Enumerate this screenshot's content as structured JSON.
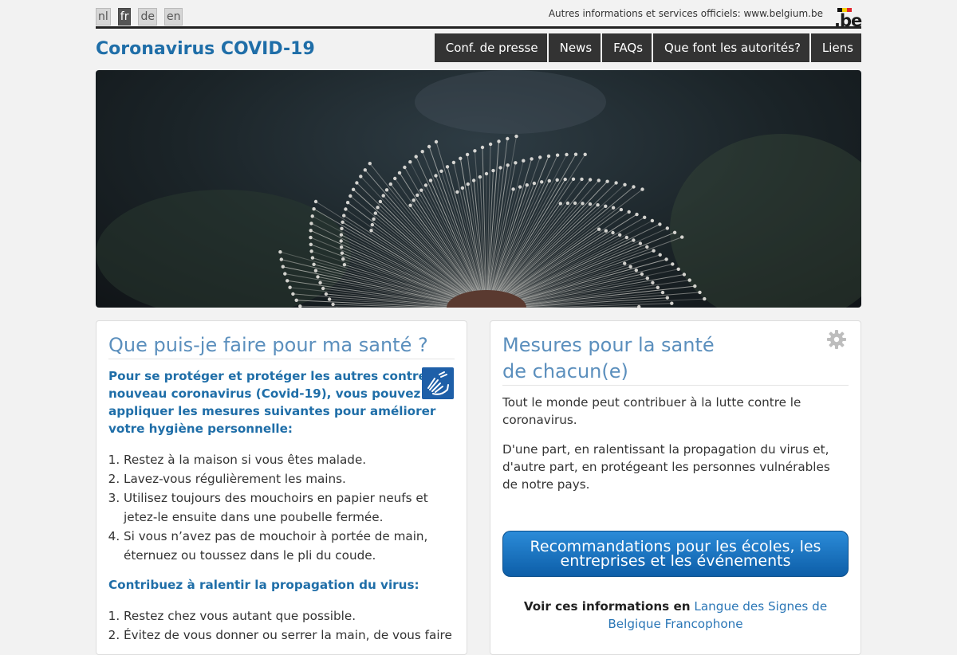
{
  "languages": [
    {
      "code": "nl",
      "active": false
    },
    {
      "code": "fr",
      "active": true
    },
    {
      "code": "de",
      "active": false
    },
    {
      "code": "en",
      "active": false
    }
  ],
  "official_link_text": "Autres informations et services officiels: www.belgium.be",
  "logo_text": ".be",
  "brand_colors": {
    "title": "#1f6ea8",
    "heading": "#5b8fbd",
    "nav_bg": "#333333",
    "button": "#1a73c2"
  },
  "site_title": "Coronavirus COVID-19",
  "nav": [
    "Conf. de presse",
    "News",
    "FAQs",
    "Que font les autorités?",
    "Liens"
  ],
  "left_card": {
    "heading": "Que puis-je faire pour ma santé ?",
    "intro": "Pour se protéger et protéger les autres contre le nouveau coronavirus (Covid-19), vous pouvez appliquer les mesures suivantes pour améliorer votre hygiène personnelle:",
    "icon": "sign-language-icon",
    "list1": [
      "Restez à la maison si vous êtes malade.",
      "Lavez-vous régulièrement les mains.",
      "Utilisez toujours des mouchoirs en papier neufs et jetez-le ensuite dans une poubelle fermée.",
      "Si vous n’avez pas de mouchoir à portée de main, éternuez ou toussez dans le pli du coude."
    ],
    "subheading": "Contribuez à ralentir la propagation du virus:",
    "list2": [
      "Restez chez vous autant que possible.",
      "Évitez de vous donner ou serrer la main, de vous faire"
    ]
  },
  "right_card": {
    "heading_line1": "Mesures pour la santé",
    "heading_line2": "de chacun(e)",
    "paragraph1": "Tout le monde peut contribuer à la lutte contre le coronavirus.",
    "paragraph2": "D'une part, en ralentissant la propagation du virus et, d'autre part, en protégeant les personnes vulnérables de notre pays.",
    "button_line1": "Recommandations pour les écoles, les",
    "button_line2": "entreprises et les événements",
    "lsf_prefix": "Voir ces informations en",
    "lsf_link_line1": "Langue des Signes de",
    "lsf_link_line2": "Belgique Francophone"
  }
}
